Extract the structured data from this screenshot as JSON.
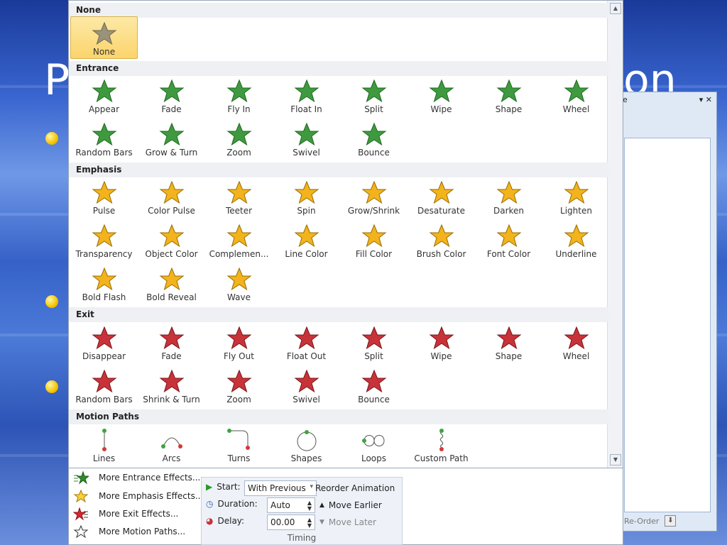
{
  "slide": {
    "title_left": "P",
    "title_right": "on"
  },
  "task_pane": {
    "title": "e",
    "controls": "▾ ✕",
    "reorder_label": "Re-Order"
  },
  "gallery": {
    "sections": [
      {
        "id": "none",
        "title": "None"
      },
      {
        "id": "entrance",
        "title": "Entrance"
      },
      {
        "id": "emphasis",
        "title": "Emphasis"
      },
      {
        "id": "exit",
        "title": "Exit"
      },
      {
        "id": "motion",
        "title": "Motion Paths"
      }
    ],
    "none": [
      {
        "label": "None",
        "selected": true
      }
    ],
    "entrance": [
      "Appear",
      "Fade",
      "Fly In",
      "Float In",
      "Split",
      "Wipe",
      "Shape",
      "Wheel",
      "Random Bars",
      "Grow & Turn",
      "Zoom",
      "Swivel",
      "Bounce"
    ],
    "emphasis": [
      "Pulse",
      "Color Pulse",
      "Teeter",
      "Spin",
      "Grow/Shrink",
      "Desaturate",
      "Darken",
      "Lighten",
      "Transparency",
      "Object Color",
      "Complemen...",
      "Line Color",
      "Fill Color",
      "Brush Color",
      "Font Color",
      "Underline",
      "Bold Flash",
      "Bold Reveal",
      "Wave"
    ],
    "exit": [
      "Disappear",
      "Fade",
      "Fly Out",
      "Float Out",
      "Split",
      "Wipe",
      "Shape",
      "Wheel",
      "Random Bars",
      "Shrink & Turn",
      "Zoom",
      "Swivel",
      "Bounce"
    ],
    "motion": [
      "Lines",
      "Arcs",
      "Turns",
      "Shapes",
      "Loops",
      "Custom Path"
    ]
  },
  "more": {
    "entrance": "More Entrance Effects...",
    "emphasis": "More Emphasis Effects...",
    "exit": "More Exit Effects...",
    "motion": "More Motion Paths..."
  },
  "timing": {
    "start_label": "Start:",
    "start_value": "With Previous",
    "duration_label": "Duration:",
    "duration_value": "Auto",
    "delay_label": "Delay:",
    "delay_value": "00.00",
    "caption": "Timing",
    "reorder_title": "Reorder Animation",
    "move_earlier": "Move Earlier",
    "move_later": "Move Later"
  },
  "colors": {
    "entrance": "#3f9a3f",
    "emphasis": "#f2b31c",
    "exit": "#c8333a",
    "motion_dot_start": "#3ea53e",
    "motion_dot_end": "#d23a3a"
  }
}
